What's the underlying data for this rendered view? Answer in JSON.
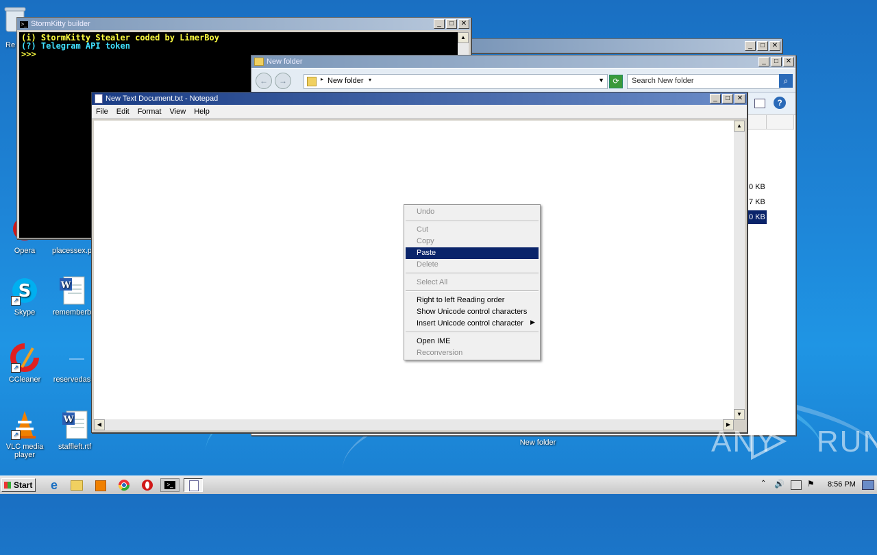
{
  "colors": {
    "accent": "#0a246a",
    "console_yellow": "#ffff40",
    "console_cyan": "#40e0ff",
    "selection": "#0a246a"
  },
  "desktop": {
    "icons": [
      {
        "label": "Re",
        "icon": "recycle-bin-icon"
      },
      {
        "label": "Opera",
        "icon": "opera-icon"
      },
      {
        "label": "placessex.p",
        "icon": "document-icon"
      },
      {
        "label": "Skype",
        "icon": "skype-icon"
      },
      {
        "label": "rememberb",
        "icon": "word-document-icon"
      },
      {
        "label": "CCleaner",
        "icon": "ccleaner-icon"
      },
      {
        "label": "reservedas",
        "icon": "document-icon"
      },
      {
        "label": "VLC media player",
        "icon": "vlc-icon"
      },
      {
        "label": "staffleft.rtf",
        "icon": "word-document-icon"
      },
      {
        "label": "New folder",
        "icon": "folder-icon"
      }
    ]
  },
  "console": {
    "title": "StormKitty builder",
    "lines": [
      "(i) StormKitty Stealer coded by LimerBoy",
      "(?) Telegram API token",
      ">>>"
    ]
  },
  "explorer": {
    "title": "New folder",
    "breadcrumb": "New folder",
    "search_placeholder": "Search New folder",
    "sizes": [
      "0 KB",
      "7 KB",
      "0 KB"
    ]
  },
  "notepad": {
    "title": "New Text Document.txt - Notepad",
    "menu": [
      "File",
      "Edit",
      "Format",
      "View",
      "Help"
    ]
  },
  "context_menu": {
    "items": [
      {
        "label": "Undo",
        "disabled": true
      },
      {
        "label": "Cut",
        "disabled": true
      },
      {
        "label": "Copy",
        "disabled": true
      },
      {
        "label": "Paste",
        "disabled": false
      },
      {
        "label": "Delete",
        "disabled": true
      },
      {
        "label": "Select All",
        "disabled": true
      },
      {
        "label": "Right to left Reading order",
        "disabled": false
      },
      {
        "label": "Show Unicode control characters",
        "disabled": false
      },
      {
        "label": "Insert Unicode control character",
        "disabled": false
      },
      {
        "label": "Open IME",
        "disabled": false
      },
      {
        "label": "Reconversion",
        "disabled": true
      }
    ]
  },
  "taskbar": {
    "start_label": "Start",
    "clock": "8:56 PM"
  },
  "watermark": "ANY RUN"
}
